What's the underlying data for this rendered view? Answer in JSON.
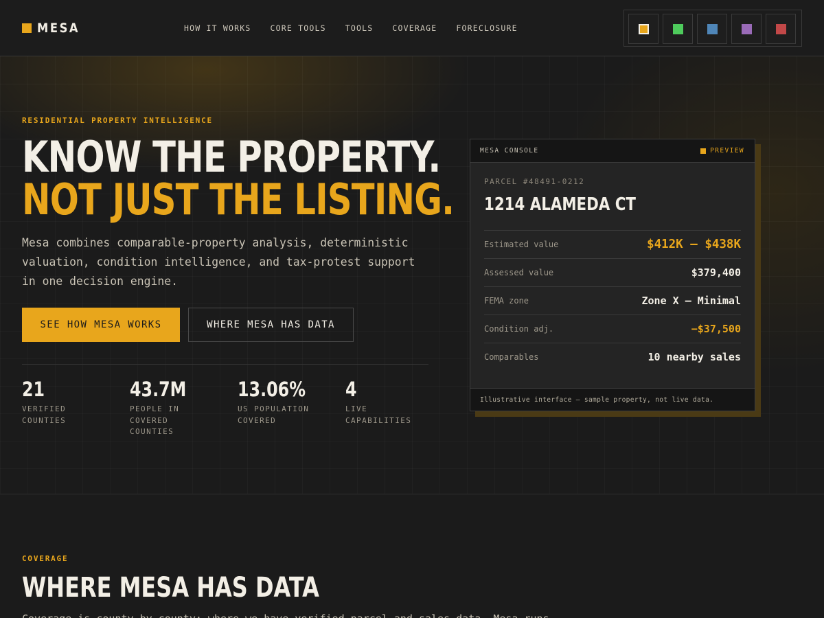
{
  "brand": {
    "name": "MESA",
    "accent": "#e8a61c"
  },
  "nav": {
    "links": [
      "HOW IT WORKS",
      "CORE TOOLS",
      "TOOLS",
      "COVERAGE",
      "FORECLOSURE"
    ],
    "swatches": [
      {
        "color": "#e8a61c",
        "active": true
      },
      {
        "color": "#4ecb5c",
        "active": false
      },
      {
        "color": "#4f86b8",
        "active": false
      },
      {
        "color": "#9a6bb8",
        "active": false
      },
      {
        "color": "#c24848",
        "active": false
      }
    ]
  },
  "hero": {
    "eyebrow": "RESIDENTIAL PROPERTY INTELLIGENCE",
    "headline_line1": "KNOW THE PROPERTY.",
    "headline_line2": "NOT JUST THE LISTING.",
    "lede": "Mesa combines comparable-property analysis, deterministic valuation, condition intelligence, and tax-protest support in one decision engine.",
    "primary_cta": "SEE HOW MESA WORKS",
    "secondary_cta": "WHERE MESA HAS DATA",
    "stats": [
      {
        "value": "21",
        "label": "VERIFIED COUNTIES"
      },
      {
        "value": "43.7M",
        "label": "PEOPLE IN COVERED COUNTIES"
      },
      {
        "value": "13.06%",
        "label": "US POPULATION COVERED"
      },
      {
        "value": "4",
        "label": "LIVE CAPABILITIES"
      }
    ]
  },
  "console": {
    "title": "MESA CONSOLE",
    "badge": "PREVIEW",
    "parcel": "PARCEL #48491-0212",
    "address": "1214 ALAMEDA CT",
    "rows": [
      {
        "label": "Estimated value",
        "value": "$412K – $438K"
      },
      {
        "label": "Assessed value",
        "value": "$379,400"
      },
      {
        "label": "FEMA zone",
        "value": "Zone X — Minimal"
      },
      {
        "label": "Condition adj.",
        "value": "−$37,500"
      },
      {
        "label": "Comparables",
        "value": "10 nearby sales"
      }
    ],
    "footer": "Illustrative interface — sample property, not live data."
  },
  "coverage": {
    "eyebrow": "COVERAGE",
    "title": "WHERE MESA HAS DATA",
    "lede": "Coverage is county-by-county: where we have verified parcel and sales data, Mesa runs."
  }
}
